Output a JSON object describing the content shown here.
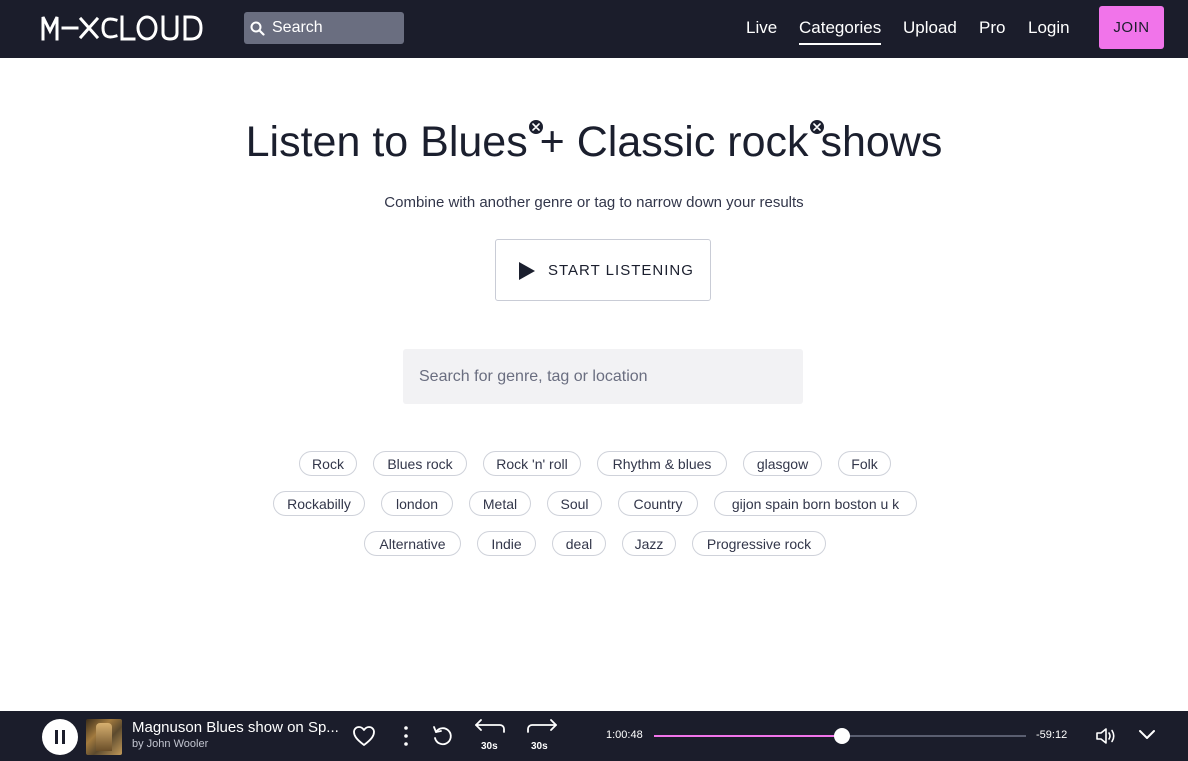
{
  "header": {
    "logo_text": "MIXCLOUD",
    "search_placeholder": "Search",
    "nav": [
      {
        "label": "Live",
        "active": false
      },
      {
        "label": "Categories",
        "active": true
      },
      {
        "label": "Upload",
        "active": false
      },
      {
        "label": "Pro",
        "active": false
      },
      {
        "label": "Login",
        "active": false
      }
    ],
    "join_label": "JOIN"
  },
  "main": {
    "headline_prefix": "Listen to",
    "genres": [
      "Blues",
      "Classic rock"
    ],
    "headline_plus": "+",
    "headline_suffix": "shows",
    "subtitle": "Combine with another genre or tag to narrow down your results",
    "start_label": "START LISTENING",
    "search_placeholder": "Search for genre, tag or location",
    "tags": [
      "Rock",
      "Blues rock",
      "Rock 'n' roll",
      "Rhythm & blues",
      "glasgow",
      "Folk",
      "Rockabilly",
      "london",
      "Metal",
      "Soul",
      "Country",
      "gijon spain born boston u k",
      "Alternative",
      "Indie",
      "deal",
      "Jazz",
      "Progressive rock"
    ]
  },
  "player": {
    "title": "Magnuson Blues show on Sp...",
    "artist": "by John Wooler",
    "rewind_label": "30s",
    "forward_label": "30s",
    "elapsed": "1:00:48",
    "remaining": "-59:12",
    "progress": 0.505
  },
  "colors": {
    "header_bg": "#1b1d2b",
    "accent_pink": "#f174ea",
    "text_dark": "#1b1f2e"
  }
}
